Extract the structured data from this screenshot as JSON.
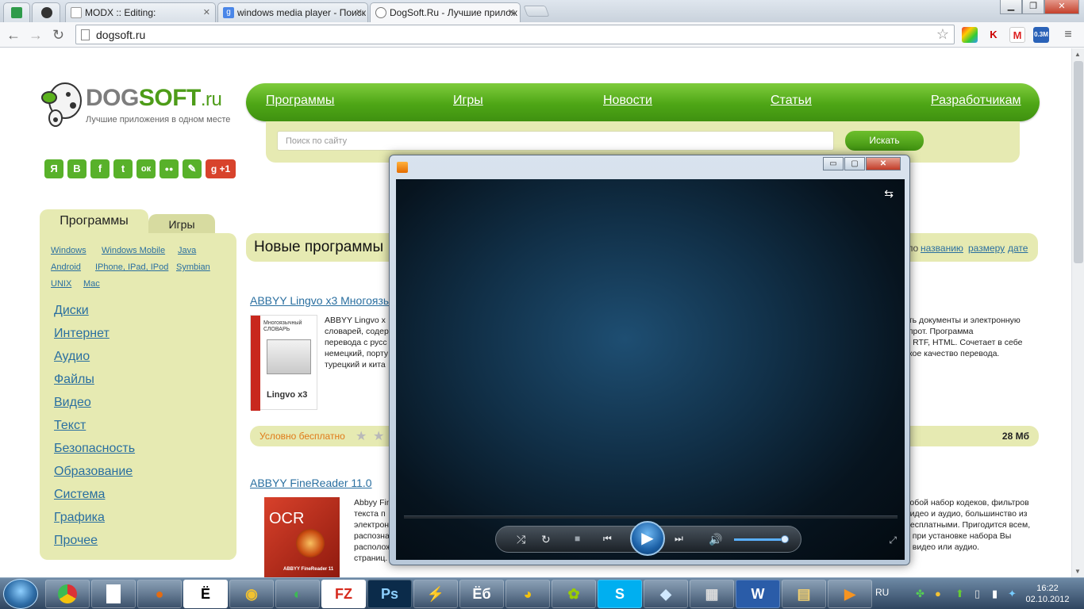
{
  "browser": {
    "tabs": [
      {
        "title": "",
        "icon": "sheets-icon"
      },
      {
        "title": "",
        "icon": "bomb-icon"
      },
      {
        "title": "MODX :: Editing:",
        "icon": "page-icon"
      },
      {
        "title": "windows media player - Поиск",
        "icon": "google-icon"
      },
      {
        "title": "DogSoft.Ru - Лучшие прилож",
        "icon": "dogsoft-icon"
      }
    ],
    "url": "dogsoft.ru",
    "ext_badge": "0.3M"
  },
  "site": {
    "logo": {
      "part1": "DOG",
      "part2": "SOFT",
      "part3": ".ru",
      "slogan": "Лучшие приложения в одном месте"
    },
    "nav": [
      "Программы",
      "Игры",
      "Новости",
      "Статьи",
      "Разработчикам"
    ],
    "search": {
      "placeholder": "Поиск по сайту",
      "button": "Искать"
    },
    "social": [
      "Я",
      "В",
      "f",
      "t",
      "ок",
      "●●",
      "✎",
      "+1"
    ],
    "sidebar": {
      "tab_active": "Программы",
      "tab_inactive": "Игры",
      "os_links": [
        "Windows",
        "Windows Mobile",
        "Java",
        "Android",
        "IPhone, IPad, IPod",
        "Symbian",
        "UNIX",
        "Mac"
      ],
      "categories": [
        "Диски",
        "Интернет",
        "Аудио",
        "Файлы",
        "Видео",
        "Текст",
        "Безопасность",
        "Образование",
        "Система",
        "Графика",
        "Прочее"
      ]
    },
    "section": {
      "title": "Новые программы",
      "sort_prefix": "по",
      "sort_links": [
        "названию",
        "размеру",
        "дате"
      ]
    },
    "programs": [
      {
        "title": "ABBYY Lingvo x3 Многоязы",
        "left_text": [
          "ABBYY Lingvo x",
          "словарей, содер",
          "перевода с русс",
          "немецкий, порту",
          "турецкий и кита"
        ],
        "right_text": [
          "ить документы и электронную",
          "рпрот. Программа",
          "F, RTF, HTML. Сочетает в себе",
          "окое качество перевода."
        ],
        "license": "Условно бесплатно",
        "size": "28 Мб",
        "box_text_top": "Многоязычный СЛОВАРЬ",
        "box_text_bottom": "Lingvo x3"
      },
      {
        "title": "ABBYY FineReader 11.0",
        "left_text": [
          "Abbyy Fin",
          "текста п",
          "электрон",
          "распозна",
          "располож",
          "страниц."
        ],
        "right_text": [
          "собой набор кодеков, фильтров",
          "видео и аудио, большинство из",
          "бесплатными. Пригодится всем,",
          "и при установке набора Вы",
          "е видео или аудио."
        ],
        "box_text_top": "OCR",
        "box_text_bottom": "ABBYY FineReader 11"
      }
    ]
  },
  "media_player": {
    "title": "",
    "buttons": {
      "minimize": "▭",
      "maximize": "▢",
      "close": "✕"
    },
    "volume_level": 0.92
  },
  "taskbar": {
    "apps": [
      "",
      "",
      "",
      "Ë",
      "",
      "",
      "FZ",
      "Ps",
      "",
      "Ёб",
      "",
      "",
      "S",
      "",
      "",
      "W",
      "",
      ""
    ],
    "lang": "RU",
    "time": "16:22",
    "date": "02.10.2012"
  }
}
